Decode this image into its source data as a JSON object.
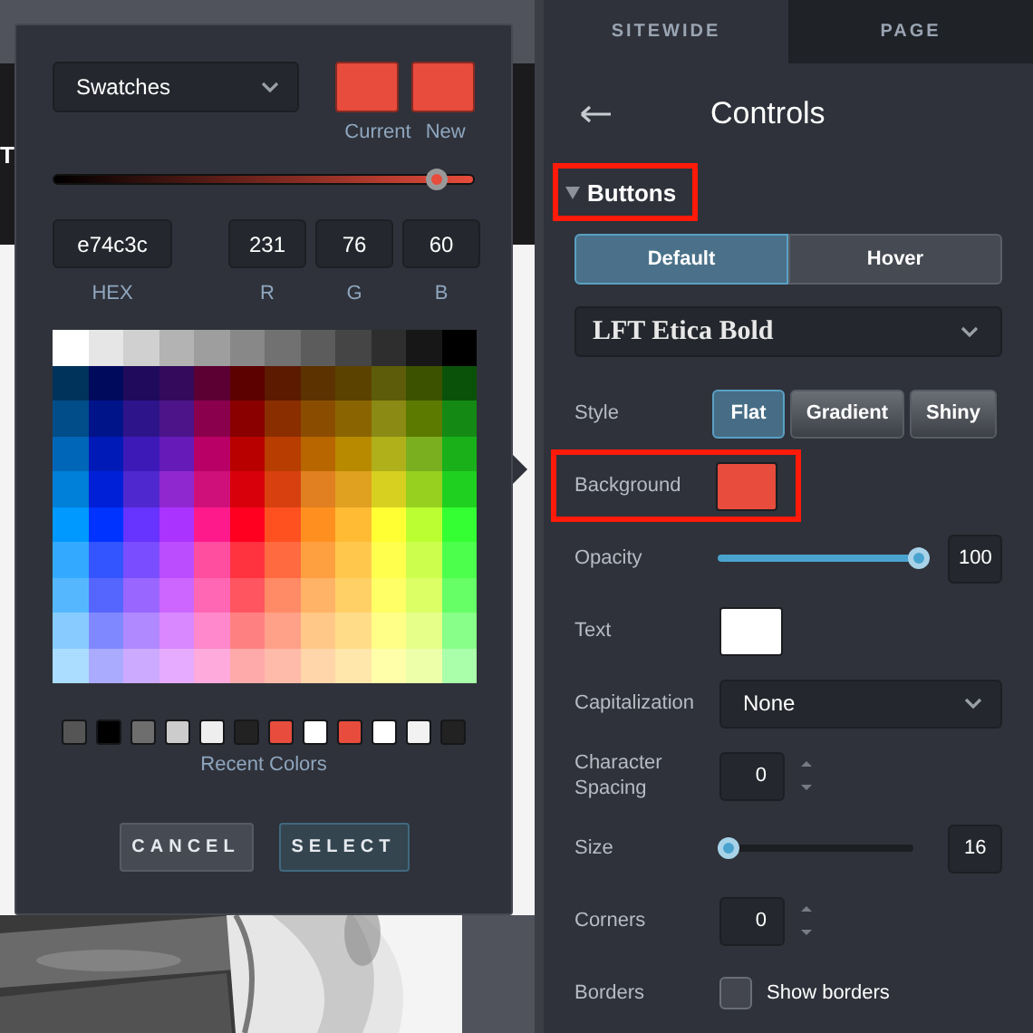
{
  "preview": {
    "banner_text": "T"
  },
  "color_picker": {
    "mode": "Swatches",
    "compare": [
      {
        "label": "Current",
        "color": "#e74c3c"
      },
      {
        "label": "New",
        "color": "#e74c3c"
      }
    ],
    "level": 0.91,
    "fields": [
      {
        "label": "HEX",
        "value": "e74c3c",
        "kind": "wide"
      },
      {
        "label": "R",
        "value": "231",
        "kind": "narrow"
      },
      {
        "label": "G",
        "value": "76",
        "kind": "narrow"
      },
      {
        "label": "B",
        "value": "60",
        "kind": "narrow"
      }
    ],
    "swatch_rows": [
      {
        "cells": [
          {
            "color": "#ffffff"
          },
          {
            "color": "#e6e6e6"
          },
          {
            "color": "#d0d0d0"
          },
          {
            "color": "#b3b3b3"
          },
          {
            "color": "#9e9e9e"
          },
          {
            "color": "#888888"
          },
          {
            "color": "#717171"
          },
          {
            "color": "#5c5c5c"
          },
          {
            "color": "#454545"
          },
          {
            "color": "#2e2e2e"
          },
          {
            "color": "#171717"
          },
          {
            "color": "#000000"
          }
        ]
      },
      {
        "cells": [
          {
            "color": "#00335c"
          },
          {
            "color": "#000a5c"
          },
          {
            "color": "#1f0a5c"
          },
          {
            "color": "#330a5c"
          },
          {
            "color": "#5c0033"
          },
          {
            "color": "#5c0000"
          },
          {
            "color": "#5c1a00"
          },
          {
            "color": "#5c3300"
          },
          {
            "color": "#5c4200"
          },
          {
            "color": "#5c5c0a"
          },
          {
            "color": "#3d5200"
          },
          {
            "color": "#0a520a"
          }
        ]
      },
      {
        "cells": [
          {
            "color": "#004d8a"
          },
          {
            "color": "#00148a"
          },
          {
            "color": "#2e148a"
          },
          {
            "color": "#4d148a"
          },
          {
            "color": "#8a004d"
          },
          {
            "color": "#8a0000"
          },
          {
            "color": "#8a2e00"
          },
          {
            "color": "#8a4d00"
          },
          {
            "color": "#8a6400"
          },
          {
            "color": "#8a8a14"
          },
          {
            "color": "#5c7a00"
          },
          {
            "color": "#148a14"
          }
        ]
      },
      {
        "cells": [
          {
            "color": "#0066b8"
          },
          {
            "color": "#001ab8"
          },
          {
            "color": "#3d1ab8"
          },
          {
            "color": "#661ab8"
          },
          {
            "color": "#b80066"
          },
          {
            "color": "#b80000"
          },
          {
            "color": "#b83d00"
          },
          {
            "color": "#b86600"
          },
          {
            "color": "#b88a00"
          },
          {
            "color": "#b0b01a"
          },
          {
            "color": "#7ab020"
          },
          {
            "color": "#1ab01a"
          }
        ]
      },
      {
        "cells": [
          {
            "color": "#0080d8"
          },
          {
            "color": "#0020d8"
          },
          {
            "color": "#5028d0"
          },
          {
            "color": "#9028d0"
          },
          {
            "color": "#d0107a"
          },
          {
            "color": "#d8000a"
          },
          {
            "color": "#d84010"
          },
          {
            "color": "#e08020"
          },
          {
            "color": "#e0a020"
          },
          {
            "color": "#d8d020"
          },
          {
            "color": "#98d020"
          },
          {
            "color": "#20d020"
          }
        ]
      },
      {
        "cells": [
          {
            "color": "#0099ff"
          },
          {
            "color": "#0033ff"
          },
          {
            "color": "#6633ff"
          },
          {
            "color": "#aa33ff"
          },
          {
            "color": "#ff1a8c"
          },
          {
            "color": "#ff0020"
          },
          {
            "color": "#ff5020"
          },
          {
            "color": "#ff9020"
          },
          {
            "color": "#ffbb33"
          },
          {
            "color": "#ffff33"
          },
          {
            "color": "#bbff33"
          },
          {
            "color": "#33ff33"
          }
        ]
      },
      {
        "cells": [
          {
            "color": "#33aaff"
          },
          {
            "color": "#3355ff"
          },
          {
            "color": "#7a4dff"
          },
          {
            "color": "#bb4dff"
          },
          {
            "color": "#ff4da0"
          },
          {
            "color": "#ff3340"
          },
          {
            "color": "#ff6a40"
          },
          {
            "color": "#ffa040"
          },
          {
            "color": "#ffc84d"
          },
          {
            "color": "#ffff4d"
          },
          {
            "color": "#ccff4d"
          },
          {
            "color": "#4dff4d"
          }
        ]
      },
      {
        "cells": [
          {
            "color": "#55b8ff"
          },
          {
            "color": "#5566ff"
          },
          {
            "color": "#9966ff"
          },
          {
            "color": "#cc66ff"
          },
          {
            "color": "#ff66b3"
          },
          {
            "color": "#ff5560"
          },
          {
            "color": "#ff8a66"
          },
          {
            "color": "#ffb366"
          },
          {
            "color": "#ffd066"
          },
          {
            "color": "#ffff66"
          },
          {
            "color": "#ddff66"
          },
          {
            "color": "#66ff66"
          }
        ]
      },
      {
        "cells": [
          {
            "color": "#88ccff"
          },
          {
            "color": "#8088ff"
          },
          {
            "color": "#b088ff"
          },
          {
            "color": "#d988ff"
          },
          {
            "color": "#ff88cc"
          },
          {
            "color": "#ff8080"
          },
          {
            "color": "#ffa088"
          },
          {
            "color": "#ffc888"
          },
          {
            "color": "#ffdd88"
          },
          {
            "color": "#ffff88"
          },
          {
            "color": "#e6ff88"
          },
          {
            "color": "#88ff88"
          }
        ]
      },
      {
        "cells": [
          {
            "color": "#aaddff"
          },
          {
            "color": "#aaaaff"
          },
          {
            "color": "#ccaaff"
          },
          {
            "color": "#e6aaff"
          },
          {
            "color": "#ffaadd"
          },
          {
            "color": "#ffaaaa"
          },
          {
            "color": "#ffbbaa"
          },
          {
            "color": "#ffd5aa"
          },
          {
            "color": "#ffe6aa"
          },
          {
            "color": "#ffffaa"
          },
          {
            "color": "#eeffaa"
          },
          {
            "color": "#aaffaa"
          }
        ]
      }
    ],
    "recent_colors": [
      {
        "color": "#555555"
      },
      {
        "color": "#000000"
      },
      {
        "color": "#6e6e6e"
      },
      {
        "color": "#cccccc"
      },
      {
        "color": "#eeeeee"
      },
      {
        "color": "#222222"
      },
      {
        "color": "#e74c3c"
      },
      {
        "color": "#ffffff"
      },
      {
        "color": "#e74c3c"
      },
      {
        "color": "#ffffff"
      },
      {
        "color": "#f2f2f2"
      },
      {
        "color": "#222222"
      }
    ],
    "recent_label": "Recent Colors",
    "buttons": [
      {
        "label": "CANCEL",
        "kind": "secondary"
      },
      {
        "label": "SELECT",
        "kind": "primary"
      }
    ]
  },
  "panel": {
    "tabs": [
      {
        "label": "SITEWIDE",
        "selected": true
      },
      {
        "label": "PAGE",
        "selected": false
      }
    ],
    "title": "Controls",
    "section": {
      "label": "Buttons",
      "expanded": true,
      "highlighted": true
    },
    "states": [
      {
        "label": "Default",
        "selected": true
      },
      {
        "label": "Hover",
        "selected": false
      }
    ],
    "font": "LFT Etica Bold",
    "rows": [
      {
        "kind": "choice",
        "label": "Style",
        "options": [
          {
            "label": "Flat",
            "selected": true
          },
          {
            "label": "Gradient",
            "selected": false
          },
          {
            "label": "Shiny",
            "selected": false
          }
        ]
      },
      {
        "kind": "color",
        "label": "Background",
        "color": "#e74c3c",
        "highlighted": true
      },
      {
        "kind": "slider",
        "label": "Opacity",
        "level": 1,
        "value": "100"
      },
      {
        "kind": "color",
        "label": "Text",
        "color": "#ffffff",
        "highlighted": false
      },
      {
        "kind": "select",
        "label": "Capitalization",
        "value": "None"
      },
      {
        "kind": "stepper",
        "label": "Character Spacing",
        "value": "0"
      },
      {
        "kind": "slider",
        "label": "Size",
        "level": 0.05,
        "value": "16"
      },
      {
        "kind": "stepper",
        "label": "Corners",
        "value": "0"
      },
      {
        "kind": "checkbox",
        "label": "Borders",
        "checked": false,
        "text": "Show borders"
      }
    ]
  }
}
